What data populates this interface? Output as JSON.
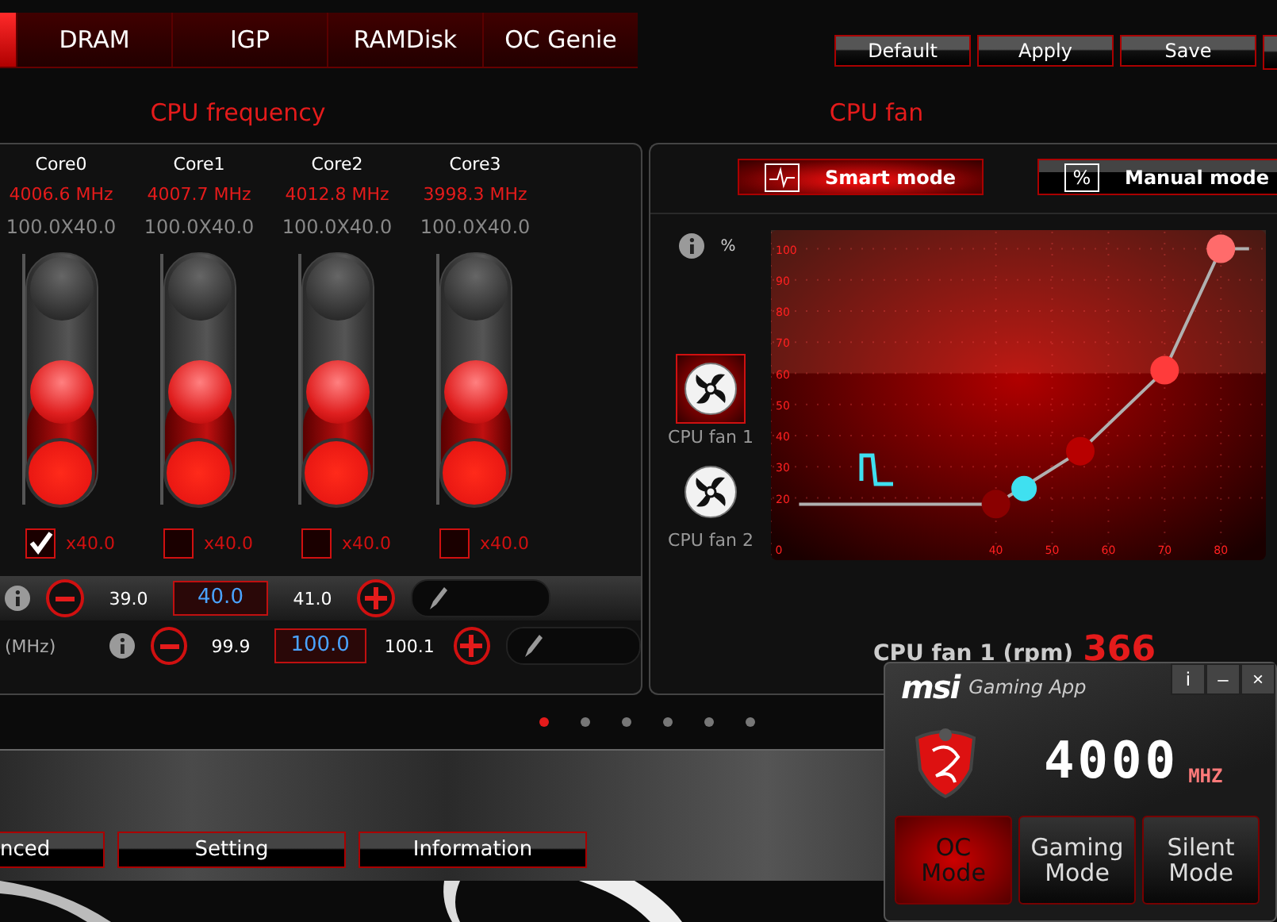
{
  "tabs": [
    {
      "selected": true
    },
    {
      "label": "DRAM",
      "selected": false
    },
    {
      "label": "IGP",
      "selected": false
    },
    {
      "label": "RAMDisk",
      "selected": false
    },
    {
      "label": "OC Genie",
      "selected": false
    }
  ],
  "toolbar_buttons": [
    "Default",
    "Apply",
    "Save"
  ],
  "cpu_frequency": {
    "title": "CPU frequency",
    "cores": [
      {
        "name": "Core0",
        "frequency": "4006.6 MHz",
        "formula": "100.0X40.0",
        "level": 0.45,
        "checked": true,
        "ratio": "x40.0"
      },
      {
        "name": "Core1",
        "frequency": "4007.7 MHz",
        "formula": "100.0X40.0",
        "level": 0.45,
        "checked": false,
        "ratio": "x40.0"
      },
      {
        "name": "Core2",
        "frequency": "4012.8 MHz",
        "formula": "100.0X40.0",
        "level": 0.45,
        "checked": false,
        "ratio": "x40.0"
      },
      {
        "name": "Core3",
        "frequency": "3998.3 MHz",
        "formula": "100.0X40.0",
        "level": 0.45,
        "checked": false,
        "ratio": "x40.0"
      }
    ],
    "steppers": [
      {
        "prev": "39.0",
        "value": "40.0",
        "next": "41.0"
      },
      {
        "label": "(MHz)",
        "prev": "99.9",
        "value": "100.0",
        "next": "100.1"
      }
    ]
  },
  "cpu_fan": {
    "title": "CPU fan",
    "modes": [
      {
        "label": "Smart mode",
        "kind": "wave",
        "selected": true
      },
      {
        "label": "Manual mode",
        "kind": "percent",
        "symbol": "%",
        "selected": false
      }
    ],
    "y_unit": "%",
    "fans": [
      {
        "label": "CPU fan 1",
        "selected": true
      },
      {
        "label": "CPU fan 2",
        "selected": false
      }
    ],
    "chart_data": {
      "type": "line",
      "xlim": [
        0,
        88
      ],
      "ylim": [
        0,
        106
      ],
      "grid": true,
      "xticks": [
        0,
        40,
        50,
        60,
        70,
        80
      ],
      "yticks": [
        20,
        30,
        40,
        50,
        60,
        70,
        80,
        90,
        100
      ],
      "bands": [
        {
          "axis": "y",
          "from": 60,
          "to": 106
        }
      ],
      "x": [
        5,
        40,
        45,
        55,
        70,
        80,
        85
      ],
      "series": [
        {
          "color": "#b0b0b0",
          "marker": "circle",
          "values": [
            18,
            18,
            null,
            35,
            61,
            100,
            100
          ]
        },
        {
          "color": "#3fe0f0",
          "marker": "circle",
          "values": [
            null,
            null,
            23,
            null,
            null,
            null,
            null
          ]
        }
      ]
    },
    "speed_label": "CPU fan 1 (rpm)",
    "speed_value": "366"
  },
  "pages": [
    {
      "selected": true
    },
    {
      "selected": false
    },
    {
      "selected": false
    },
    {
      "selected": false
    },
    {
      "selected": false
    },
    {
      "selected": false
    }
  ],
  "bottom_buttons": [
    "nced",
    "Setting",
    "Information"
  ],
  "gaming_app": {
    "brand": "msi",
    "title": "Gaming App",
    "window_buttons": [
      "i",
      "–",
      "×"
    ],
    "frequency": "4000",
    "unit": "MHZ",
    "modes": [
      {
        "label": "OC\nMode",
        "selected": true
      },
      {
        "label": "Gaming\nMode",
        "selected": false
      },
      {
        "label": "Silent\nMode",
        "selected": false
      }
    ]
  }
}
